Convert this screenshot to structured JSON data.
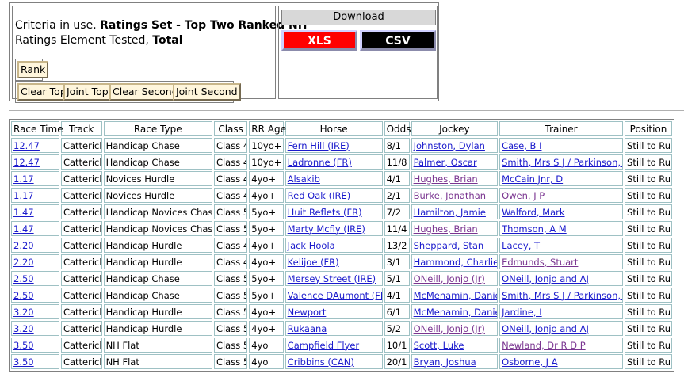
{
  "criteria": {
    "prefix1": "Criteria in use. ",
    "ratings_set": "Ratings Set - Top Two Ranked NH",
    "prefix2": "Ratings Element Tested, ",
    "element": "Total"
  },
  "buttons": {
    "rank": "Rank",
    "clear_top": "Clear Top",
    "joint_top": "Joint Top",
    "clear_second": "Clear Second",
    "joint_second": "Joint Second"
  },
  "download": {
    "title": "Download",
    "xls": "XLS",
    "csv": "CSV",
    "xls_color": "#ff0000",
    "csv_color": "#000000"
  },
  "table": {
    "headers": [
      "Race Time",
      "Track",
      "Race Type",
      "Class",
      "RR Age",
      "Horse",
      "Odds",
      "Jockey",
      "Trainer",
      "Position"
    ],
    "rows": [
      [
        "12.47",
        "Catterick",
        "Handicap Chase",
        "Class 4",
        "10yo+",
        "Fern Hill (IRE)",
        "8/1",
        "Johnston, Dylan",
        "Case, B I",
        "Still to Run"
      ],
      [
        "12.47",
        "Catterick",
        "Handicap Chase",
        "Class 4",
        "10yo+",
        "Ladronne (FR)",
        "11/8",
        "Palmer, Oscar",
        "Smith, Mrs S J / Parkinson, J",
        "Still to Run"
      ],
      [
        "1.17",
        "Catterick",
        "Novices Hurdle",
        "Class 4",
        "4yo+",
        "Alsakib",
        "4/1",
        "Hughes, Brian",
        "McCain Jnr, D",
        "Still to Run"
      ],
      [
        "1.17",
        "Catterick",
        "Novices Hurdle",
        "Class 4",
        "4yo+",
        "Red Oak (IRE)",
        "2/1",
        "Burke, Jonathan",
        "Owen, J P",
        "Still to Run"
      ],
      [
        "1.47",
        "Catterick",
        "Handicap Novices Chase",
        "Class 5",
        "5yo+",
        "Huit Reflets (FR)",
        "7/2",
        "Hamilton, Jamie",
        "Walford, Mark",
        "Still to Run"
      ],
      [
        "1.47",
        "Catterick",
        "Handicap Novices Chase",
        "Class 5",
        "5yo+",
        "Marty Mcfly (IRE)",
        "11/4",
        "Hughes, Brian",
        "Thomson, A M",
        "Still to Run"
      ],
      [
        "2.20",
        "Catterick",
        "Handicap Hurdle",
        "Class 4",
        "4yo+",
        "Jack Hoola",
        "13/2",
        "Sheppard, Stan",
        "Lacey, T",
        "Still to Run"
      ],
      [
        "2.20",
        "Catterick",
        "Handicap Hurdle",
        "Class 4",
        "4yo+",
        "Kelijoe (FR)",
        "3/1",
        "Hammond, Charlie",
        "Edmunds, Stuart",
        "Still to Run"
      ],
      [
        "2.50",
        "Catterick",
        "Handicap Chase",
        "Class 5",
        "5yo+",
        "Mersey Street (IRE)",
        "5/1",
        "ONeill, Jonjo (Jr)",
        "ONeill, Jonjo and AJ",
        "Still to Run"
      ],
      [
        "2.50",
        "Catterick",
        "Handicap Chase",
        "Class 5",
        "5yo+",
        "Valence DAumont (FR)",
        "4/1",
        "McMenamin, Daniel",
        "Smith, Mrs S J / Parkinson, J",
        "Still to Run"
      ],
      [
        "3.20",
        "Catterick",
        "Handicap Hurdle",
        "Class 5",
        "4yo+",
        "Newport",
        "6/1",
        "McMenamin, Daniel",
        "Jardine, I",
        "Still to Run"
      ],
      [
        "3.20",
        "Catterick",
        "Handicap Hurdle",
        "Class 5",
        "4yo+",
        "Rukaana",
        "5/2",
        "ONeill, Jonjo (Jr)",
        "ONeill, Jonjo and AJ",
        "Still to Run"
      ],
      [
        "3.50",
        "Catterick",
        "NH Flat",
        "Class 5",
        "4yo",
        "Campfield Flyer",
        "10/1",
        "Scott, Luke",
        "Newland, Dr R D P",
        "Still to Run"
      ],
      [
        "3.50",
        "Catterick",
        "NH Flat",
        "Class 5",
        "4yo",
        "Cribbins (CAN)",
        "20/1",
        "Bryan, Joshua",
        "Osborne, J A",
        "Still to Run"
      ]
    ],
    "visited": {
      "jockey": [
        0,
        0,
        1,
        1,
        0,
        1,
        0,
        0,
        1,
        0,
        0,
        1,
        0,
        0
      ],
      "trainer": [
        0,
        0,
        0,
        1,
        0,
        0,
        0,
        1,
        0,
        0,
        0,
        0,
        1,
        0
      ]
    }
  }
}
